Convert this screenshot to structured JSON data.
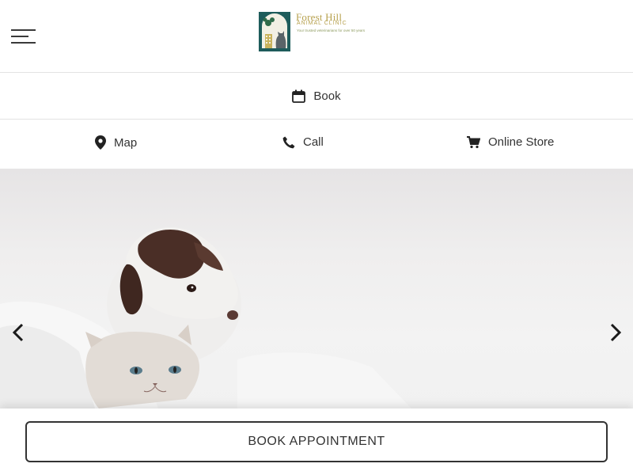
{
  "header": {
    "menu_icon": "hamburger-menu-icon",
    "logo": {
      "name": "Forest Hill",
      "subtitle": "ANIMAL CLINIC",
      "tagline": "Your trusted veterinarians for over 50 years",
      "colors": {
        "gold": "#b7a14e",
        "teal": "#1e5c5b"
      }
    }
  },
  "book_bar": {
    "icon": "calendar-icon",
    "label": "Book"
  },
  "quick_links": [
    {
      "icon": "map-pin-icon",
      "label": "Map"
    },
    {
      "icon": "phone-icon",
      "label": "Call"
    },
    {
      "icon": "shopping-cart-icon",
      "label": "Online Store"
    }
  ],
  "hero": {
    "prev_icon": "chevron-left-icon",
    "next_icon": "chevron-right-icon"
  },
  "cta": {
    "label": "BOOK APPOINTMENT"
  }
}
